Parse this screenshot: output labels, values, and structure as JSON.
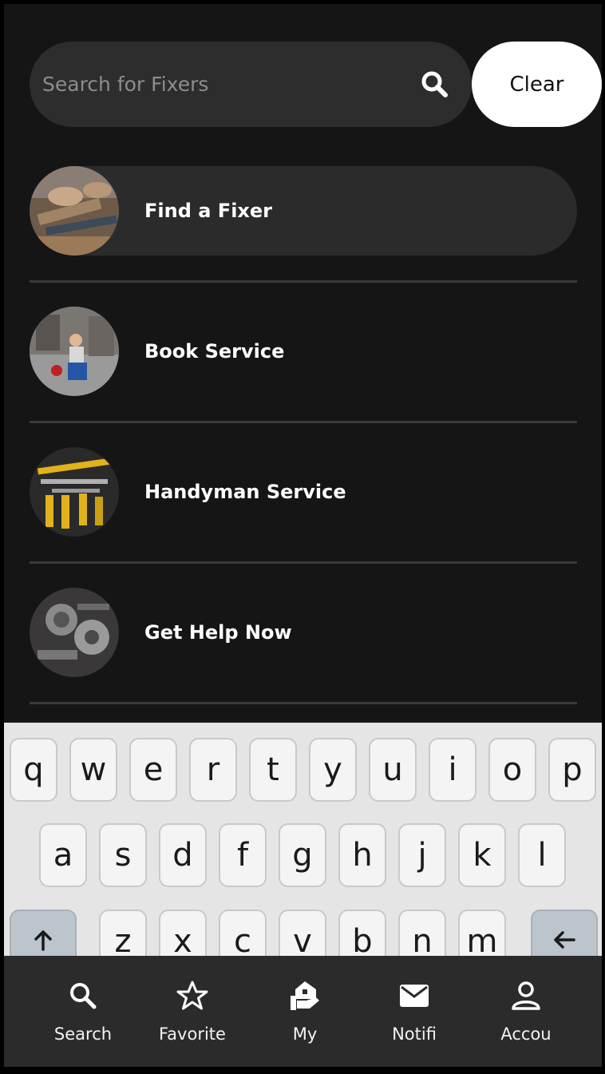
{
  "search": {
    "placeholder": "Search for Fixers",
    "value": "",
    "clear_label": "Clear"
  },
  "menu": {
    "items": [
      {
        "label": "Find a Fixer"
      },
      {
        "label": "Book Service"
      },
      {
        "label": "Handyman Service"
      },
      {
        "label": "Get Help Now"
      }
    ]
  },
  "keyboard": {
    "row1": [
      "q",
      "w",
      "e",
      "r",
      "t",
      "y",
      "u",
      "i",
      "o",
      "p"
    ],
    "row2": [
      "a",
      "s",
      "d",
      "f",
      "g",
      "h",
      "j",
      "k",
      "l"
    ],
    "row3": [
      "z",
      "x",
      "c",
      "v",
      "b",
      "n",
      "m"
    ],
    "shift_icon": "arrow-up-icon",
    "backspace_icon": "arrow-left-icon"
  },
  "tabbar": {
    "items": [
      {
        "label": "Search",
        "icon": "search-icon"
      },
      {
        "label": "Favorite",
        "icon": "star-icon"
      },
      {
        "label": "My",
        "icon": "hand-house-icon"
      },
      {
        "label": "Notifi",
        "icon": "mail-icon"
      },
      {
        "label": "Accou",
        "icon": "person-icon"
      }
    ]
  },
  "colors": {
    "background": "#151515",
    "highlight_row": "#2b2b2b",
    "search_bar": "#2d2d2d",
    "clear_button": "#ffffff",
    "tabbar": "#2b2b2b",
    "keyboard": "#e5e5e6"
  }
}
